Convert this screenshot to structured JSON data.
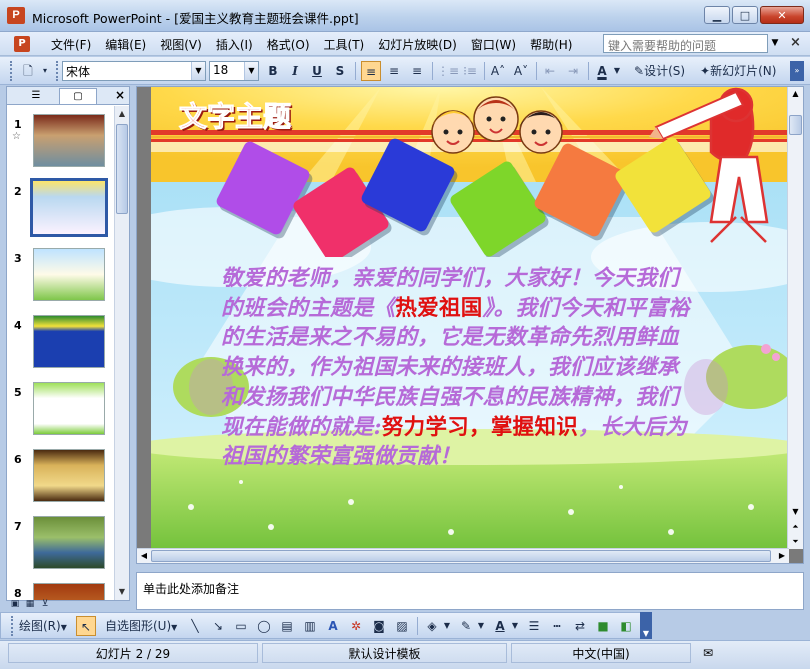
{
  "window": {
    "title": "Microsoft PowerPoint - [爱国主义教育主题班会课件.ppt]",
    "app_icon": "P",
    "minimize": "▁",
    "maximize": "□",
    "close": "✕"
  },
  "menubar": {
    "items": [
      {
        "label": "文件(F)"
      },
      {
        "label": "编辑(E)"
      },
      {
        "label": "视图(V)"
      },
      {
        "label": "插入(I)"
      },
      {
        "label": "格式(O)"
      },
      {
        "label": "工具(T)"
      },
      {
        "label": "幻灯片放映(D)"
      },
      {
        "label": "窗口(W)"
      },
      {
        "label": "帮助(H)"
      }
    ],
    "help_placeholder": "键入需要帮助的问题",
    "close_glyph": "×"
  },
  "toolbar": {
    "font_name": "宋体",
    "font_size": "18",
    "bold": "B",
    "italic": "I",
    "underline": "U",
    "shadow": "S",
    "align_left": "≡",
    "align_center": "≡",
    "align_right": "≡",
    "numbering": "⋮≡",
    "bullets": "⁝≡",
    "increase_font": "A˄",
    "decrease_font": "A˅",
    "decrease_indent": "⇤",
    "increase_indent": "⇥",
    "font_color": "A",
    "design": "设计(S)",
    "new_slide": "新幻灯片(N)"
  },
  "left_pane": {
    "tab_outline": "☰",
    "tab_slides": "▢",
    "close": "×",
    "slides": [
      {
        "num": "1",
        "star": "☆"
      },
      {
        "num": "2",
        "star": ""
      },
      {
        "num": "3",
        "star": ""
      },
      {
        "num": "4",
        "star": ""
      },
      {
        "num": "5",
        "star": ""
      },
      {
        "num": "6",
        "star": ""
      },
      {
        "num": "7",
        "star": ""
      },
      {
        "num": "8",
        "star": ""
      }
    ],
    "selected_index": 2
  },
  "slide": {
    "title": "文字主题",
    "body_parts": [
      {
        "text": "敬爱的老师，亲爱的同学们，大家好！今天我们的班会的主题是《",
        "red": false
      },
      {
        "text": "热爱祖国",
        "red": true
      },
      {
        "text": "》。我们今天和平富裕的生活是来之不易的，它是无数革命先烈用鲜血换来的，作为祖国未来的接班人，我们应该继承和发扬我们中华民族自强不息的民族精神，我们现在能做的就是:",
        "red": false
      },
      {
        "text": "努力学习，掌握知识",
        "red": true
      },
      {
        "text": "，长大后为祖国的繁荣富强做贡献！",
        "red": false
      }
    ],
    "diamond_colors": [
      "#b04de8",
      "#f0306a",
      "#2a3ad8",
      "#7ed62a",
      "#f57a40",
      "#f2e23a"
    ],
    "colors": {
      "title": "#e8321e",
      "body": "#b66ad8",
      "highlight": "#e01010"
    }
  },
  "notes": {
    "placeholder": "单击此处添加备注"
  },
  "drawbar": {
    "draw": "绘图(R)",
    "autoshapes": "自选图形(U)"
  },
  "status": {
    "slide_counter": "幻灯片 2 / 29",
    "template": "默认设计模板",
    "language": "中文(中国)"
  }
}
